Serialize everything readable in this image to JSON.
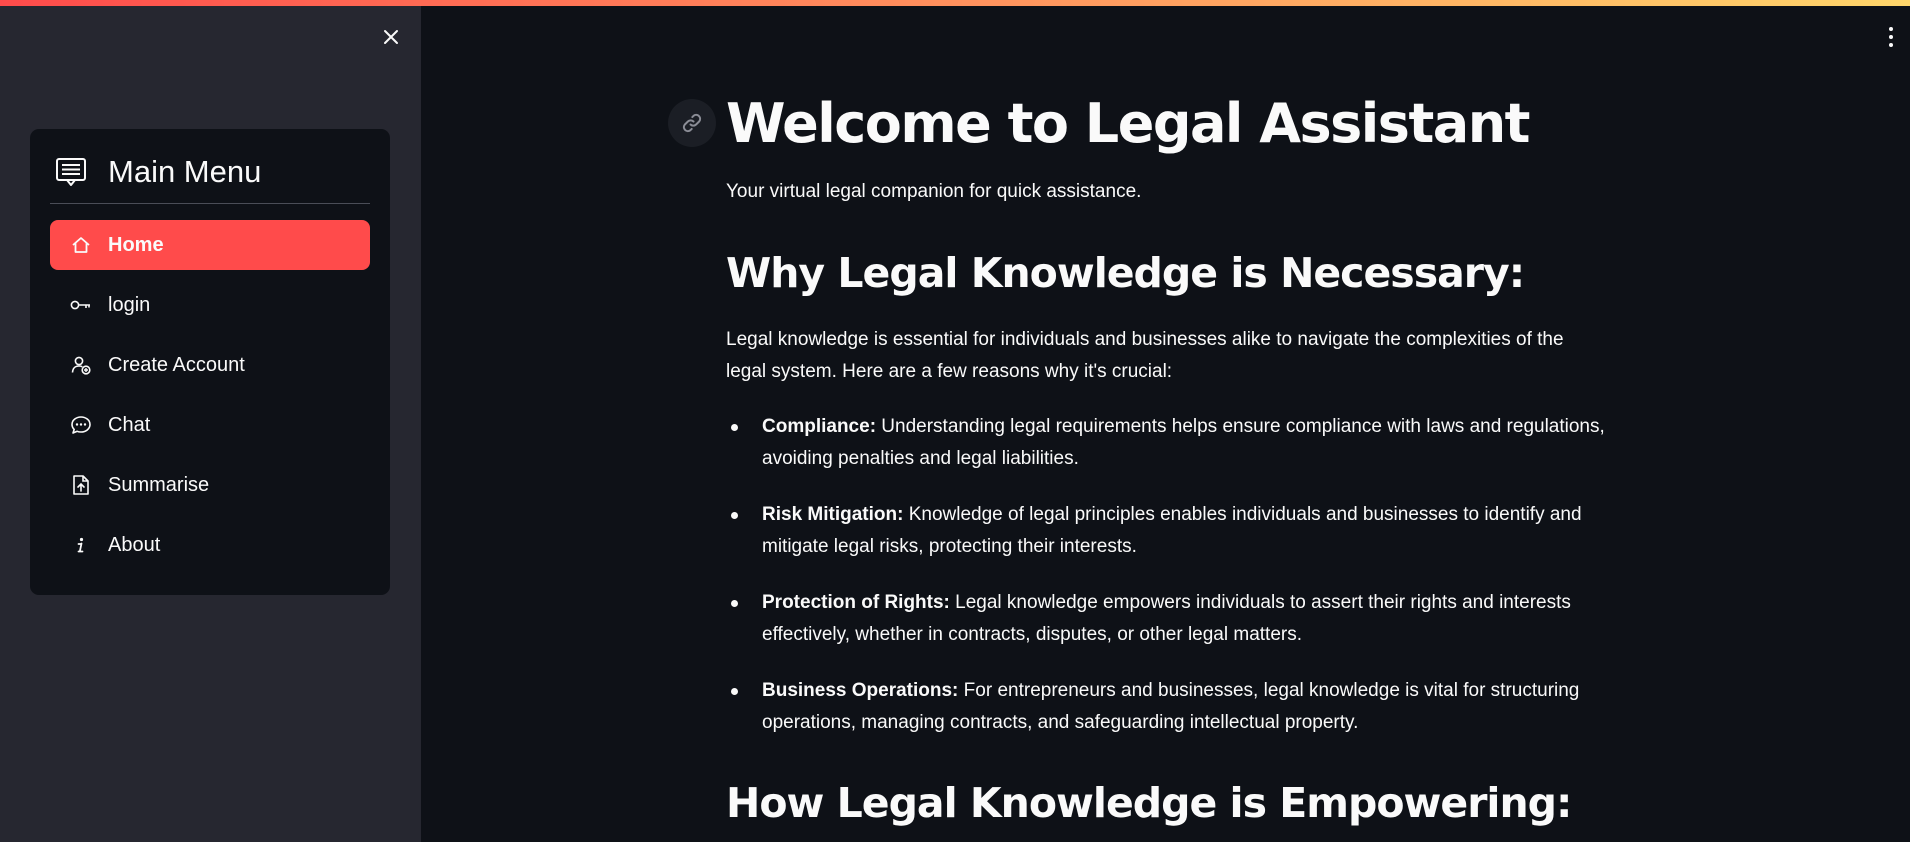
{
  "sidebar": {
    "menu_title": "Main Menu",
    "items": [
      {
        "label": "Home",
        "icon": "house-icon",
        "active": true
      },
      {
        "label": "login",
        "icon": "key-icon",
        "active": false
      },
      {
        "label": "Create Account",
        "icon": "person-add-icon",
        "active": false
      },
      {
        "label": "Chat",
        "icon": "chat-dots-icon",
        "active": false
      },
      {
        "label": "Summarise",
        "icon": "file-upload-icon",
        "active": false
      },
      {
        "label": "About",
        "icon": "info-icon",
        "active": false
      }
    ]
  },
  "main": {
    "title": "Welcome to Legal Assistant",
    "subtitle": "Your virtual legal companion for quick assistance.",
    "section1_heading": "Why Legal Knowledge is Necessary:",
    "section1_intro": "Legal knowledge is essential for individuals and businesses alike to navigate the complexities of the legal system. Here are a few reasons why it's crucial:",
    "reasons": [
      {
        "term": "Compliance:",
        "text": " Understanding legal requirements helps ensure compliance with laws and regulations, avoiding penalties and legal liabilities."
      },
      {
        "term": "Risk Mitigation:",
        "text": " Knowledge of legal principles enables individuals and businesses to identify and mitigate legal risks, protecting their interests."
      },
      {
        "term": "Protection of Rights:",
        "text": " Legal knowledge empowers individuals to assert their rights and interests effectively, whether in contracts, disputes, or other legal matters."
      },
      {
        "term": "Business Operations:",
        "text": " For entrepreneurs and businesses, legal knowledge is vital for structuring operations, managing contracts, and safeguarding intellectual property."
      }
    ],
    "section2_heading": "How Legal Knowledge is Empowering:"
  },
  "colors": {
    "accent": "#ff4b4b",
    "background": "#0e1117",
    "sidebar": "#262730",
    "text": "#fafafa"
  }
}
